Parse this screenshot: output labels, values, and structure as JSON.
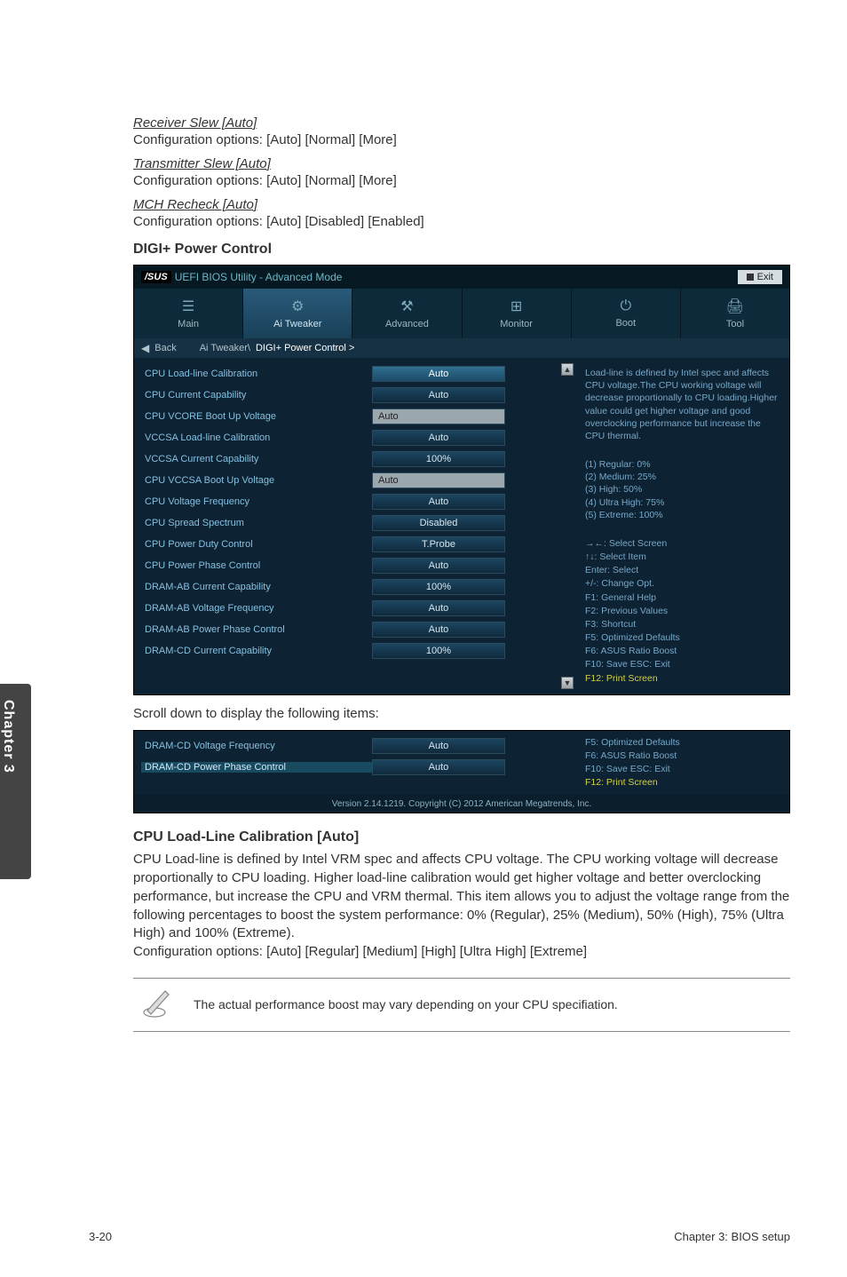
{
  "settings_pre": [
    {
      "title": "Receiver Slew [Auto]",
      "opts": "Configuration options: [Auto] [Normal] [More]"
    },
    {
      "title": "Transmitter Slew [Auto]",
      "opts": "Configuration options: [Auto] [Normal] [More]"
    },
    {
      "title": "MCH Recheck [Auto]",
      "opts": "Configuration options: [Auto] [Disabled] [Enabled]"
    }
  ],
  "section_heading": "DIGI+ Power Control",
  "bios": {
    "title_brand": "/SUS",
    "title_rest": "UEFI BIOS Utility - Advanced Mode",
    "exit": "Exit",
    "tabs": [
      "Main",
      "Ai Tweaker",
      "Advanced",
      "Monitor",
      "Boot",
      "Tool"
    ],
    "back": "Back",
    "breadcrumb_a": "Ai Tweaker\\ ",
    "breadcrumb_b": "DIGI+ Power Control >",
    "rows": [
      {
        "lbl": "CPU Load-line Calibration",
        "val": "Auto",
        "sel": true
      },
      {
        "lbl": "CPU Current Capability",
        "val": "Auto"
      },
      {
        "lbl": "CPU VCORE Boot Up Voltage",
        "val": "Auto",
        "input": true
      },
      {
        "lbl": "VCCSA Load-line Calibration",
        "val": "Auto"
      },
      {
        "lbl": "VCCSA Current Capability",
        "val": "100%"
      },
      {
        "lbl": "CPU VCCSA Boot Up Voltage",
        "val": "Auto",
        "input": true
      },
      {
        "lbl": "CPU Voltage Frequency",
        "val": "Auto"
      },
      {
        "lbl": "CPU Spread Spectrum",
        "val": "Disabled"
      },
      {
        "lbl": "CPU Power Duty Control",
        "val": "T.Probe"
      },
      {
        "lbl": "CPU Power Phase Control",
        "val": "Auto"
      },
      {
        "lbl": "DRAM-AB Current Capability",
        "val": "100%"
      },
      {
        "lbl": "DRAM-AB Voltage Frequency",
        "val": "Auto"
      },
      {
        "lbl": "DRAM-AB Power Phase Control",
        "val": "Auto"
      },
      {
        "lbl": "DRAM-CD Current Capability",
        "val": "100%"
      }
    ],
    "help_top": "Load-line is defined by Intel spec and affects CPU voltage.The CPU working voltage will decrease proportionally to CPU loading.Higher value could get higher voltage and good overclocking performance but increase the CPU thermal.",
    "help_levels": [
      "(1) Regular: 0%",
      "(2) Medium: 25%",
      "(3) High: 50%",
      "(4) Ultra High: 75%",
      "(5) Extreme: 100%"
    ],
    "help_keys": [
      "→←: Select Screen",
      "↑↓: Select Item",
      "Enter: Select",
      "+/-: Change Opt.",
      "F1: General Help",
      "F2: Previous Values",
      "F3: Shortcut",
      "F5: Optimized Defaults",
      "F6: ASUS Ratio Boost",
      "F10: Save  ESC: Exit"
    ],
    "help_last": "F12: Print Screen"
  },
  "scroll_note": "Scroll down to display the following items:",
  "bios2": {
    "rows": [
      {
        "lbl": "DRAM-CD Voltage Frequency",
        "val": "Auto"
      },
      {
        "lbl": "DRAM-CD Power Phase Control",
        "val": "Auto",
        "hl": true
      }
    ],
    "help_keys": [
      "F5: Optimized Defaults",
      "F6: ASUS Ratio Boost",
      "F10: Save  ESC: Exit"
    ],
    "help_last": "F12: Print Screen",
    "footer": "Version 2.14.1219. Copyright (C) 2012 American Megatrends, Inc."
  },
  "sub_heading": "CPU Load-Line Calibration [Auto]",
  "sub_body": "CPU Load-line is defined by Intel VRM spec and affects CPU voltage. The CPU working voltage will decrease proportionally to CPU loading. Higher load-line calibration would get higher voltage and better overclocking performance, but increase the CPU and VRM thermal. This item allows you to adjust the voltage range from the following percentages to boost the system performance: 0% (Regular), 25% (Medium), 50% (High), 75% (Ultra High) and 100% (Extreme).",
  "sub_cfg": "Configuration options: [Auto] [Regular] [Medium] [High] [Ultra High] [Extreme]",
  "note": "The actual performance boost may vary depending on your CPU specifiation.",
  "chapter": "Chapter 3",
  "footer_left": "3-20",
  "footer_right": "Chapter 3: BIOS setup"
}
